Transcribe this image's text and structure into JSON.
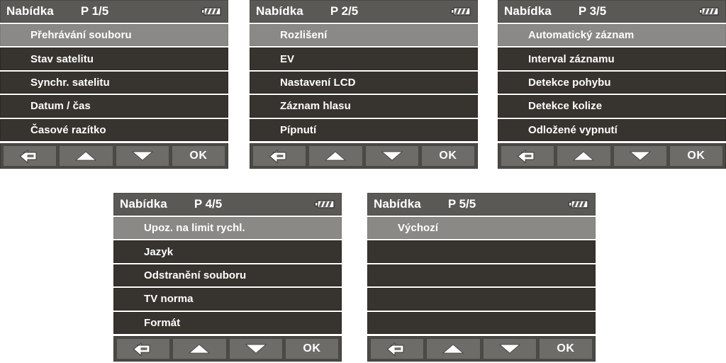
{
  "colors": {
    "page_background": "#ffffff",
    "header_background": "#5b5955",
    "row_background": "#373430",
    "row_selected_background": "#8b8986",
    "button_bar_background": "#4c4a46",
    "button_background": "#6e6c69",
    "text": "#ffffff"
  },
  "common": {
    "title": "Nabídka",
    "buttons": [
      {
        "name": "back",
        "label": "",
        "icon": "return-arrow-icon"
      },
      {
        "name": "up",
        "label": "",
        "icon": "triangle-up-icon"
      },
      {
        "name": "down",
        "label": "",
        "icon": "triangle-down-icon"
      },
      {
        "name": "ok",
        "label": "OK",
        "icon": ""
      }
    ],
    "battery_icon": "battery-full-icon"
  },
  "panels": [
    {
      "id": "panel-1",
      "title": "Nabídka",
      "page": "P 1/5",
      "battery": "battery-full-icon",
      "rows": [
        {
          "label": "Přehrávání souboru",
          "selected": true
        },
        {
          "label": "Stav satelitu",
          "selected": false
        },
        {
          "label": "Synchr. satelitu",
          "selected": false
        },
        {
          "label": "Datum / čas",
          "selected": false
        },
        {
          "label": "Časové razítko",
          "selected": false
        }
      ],
      "buttons": [
        {
          "label": "",
          "icon": "return-arrow-icon"
        },
        {
          "label": "",
          "icon": "triangle-up-icon"
        },
        {
          "label": "",
          "icon": "triangle-down-icon"
        },
        {
          "label": "OK",
          "icon": ""
        }
      ]
    },
    {
      "id": "panel-2",
      "title": "Nabídka",
      "page": "P 2/5",
      "battery": "battery-full-icon",
      "rows": [
        {
          "label": "Rozlišení",
          "selected": true
        },
        {
          "label": "EV",
          "selected": false
        },
        {
          "label": "Nastavení LCD",
          "selected": false
        },
        {
          "label": "Záznam hlasu",
          "selected": false
        },
        {
          "label": "Pípnutí",
          "selected": false
        }
      ],
      "buttons": [
        {
          "label": "",
          "icon": "return-arrow-icon"
        },
        {
          "label": "",
          "icon": "triangle-up-icon"
        },
        {
          "label": "",
          "icon": "triangle-down-icon"
        },
        {
          "label": "OK",
          "icon": ""
        }
      ]
    },
    {
      "id": "panel-3",
      "title": "Nabídka",
      "page": "P 3/5",
      "battery": "battery-full-icon",
      "rows": [
        {
          "label": "Automatický záznam",
          "selected": true
        },
        {
          "label": "Interval záznamu",
          "selected": false
        },
        {
          "label": "Detekce pohybu",
          "selected": false
        },
        {
          "label": "Detekce kolize",
          "selected": false
        },
        {
          "label": "Odložené vypnutí",
          "selected": false
        }
      ],
      "buttons": [
        {
          "label": "",
          "icon": "return-arrow-icon"
        },
        {
          "label": "",
          "icon": "triangle-up-icon"
        },
        {
          "label": "",
          "icon": "triangle-down-icon"
        },
        {
          "label": "OK",
          "icon": ""
        }
      ]
    },
    {
      "id": "panel-4",
      "title": "Nabídka",
      "page": "P 4/5",
      "battery": "battery-full-icon",
      "rows": [
        {
          "label": "Upoz. na limit rychl.",
          "selected": true
        },
        {
          "label": "Jazyk",
          "selected": false
        },
        {
          "label": "Odstranění souboru",
          "selected": false
        },
        {
          "label": "TV norma",
          "selected": false
        },
        {
          "label": "Formát",
          "selected": false
        }
      ],
      "buttons": [
        {
          "label": "",
          "icon": "return-arrow-icon"
        },
        {
          "label": "",
          "icon": "triangle-up-icon"
        },
        {
          "label": "",
          "icon": "triangle-down-icon"
        },
        {
          "label": "OK",
          "icon": ""
        }
      ]
    },
    {
      "id": "panel-5",
      "title": "Nabídka",
      "page": "P 5/5",
      "battery": "battery-full-icon",
      "rows": [
        {
          "label": "Výchozí",
          "selected": true
        },
        {
          "label": "",
          "selected": false
        },
        {
          "label": "",
          "selected": false
        },
        {
          "label": "",
          "selected": false
        },
        {
          "label": "",
          "selected": false
        }
      ],
      "buttons": [
        {
          "label": "",
          "icon": "return-arrow-icon"
        },
        {
          "label": "",
          "icon": "triangle-up-icon"
        },
        {
          "label": "",
          "icon": "triangle-down-icon"
        },
        {
          "label": "OK",
          "icon": ""
        }
      ]
    }
  ]
}
